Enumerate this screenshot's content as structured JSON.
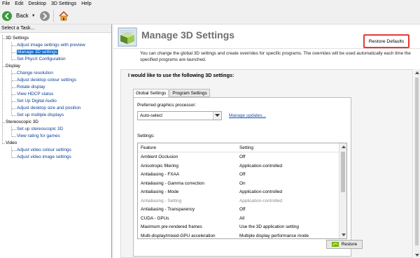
{
  "menu": [
    "File",
    "Edit",
    "Desktop",
    "3D Settings",
    "Help"
  ],
  "toolbar": {
    "back_label": "Back"
  },
  "sidebar": {
    "title": "Select a Task...",
    "tree": [
      {
        "label": "3D Settings",
        "children": [
          "Adjust image settings with preview",
          "Manage 3D settings",
          "Set PhysX Configuration"
        ]
      },
      {
        "label": "Display",
        "children": [
          "Change resolution",
          "Adjust desktop colour settings",
          "Rotate display",
          "View HDCP status",
          "Set Up Digital Audio",
          "Adjust desktop size and position",
          "Set up multiple displays"
        ]
      },
      {
        "label": "Stereoscopic 3D",
        "children": [
          "Set up stereoscopic 3D",
          "View rating for games"
        ]
      },
      {
        "label": "Video",
        "children": [
          "Adjust video colour settings",
          "Adjust video image settings"
        ]
      }
    ],
    "selected": "Manage 3D settings"
  },
  "main": {
    "title": "Manage 3D Settings",
    "restore_defaults": "Restore Defaults",
    "description": "You can change the global 3D settings and create overrides for specific programs. The overrides will be used automatically each time the specified programs are launched.",
    "section_title": "I would like to use the following 3D settings:",
    "tabs": [
      "Global Settings",
      "Program Settings"
    ],
    "preferred_label": "Preferred graphics processor:",
    "preferred_value": "Auto-select",
    "manage_updates": "Manage updates...",
    "settings_label": "Settings:",
    "columns": [
      "Feature",
      "Setting"
    ],
    "rows": [
      {
        "feature": "Ambient Occlusion",
        "setting": "Off",
        "disabled": false
      },
      {
        "feature": "Anisotropic filtering",
        "setting": "Application-controlled",
        "disabled": false
      },
      {
        "feature": "Antialiasing - FXAA",
        "setting": "Off",
        "disabled": false
      },
      {
        "feature": "Antialiasing - Gamma correction",
        "setting": "On",
        "disabled": false
      },
      {
        "feature": "Antialiasing - Mode",
        "setting": "Application-controlled",
        "disabled": false
      },
      {
        "feature": "Antialiasing - Setting",
        "setting": "Application-controlled",
        "disabled": true
      },
      {
        "feature": "Antialiasing - Transparency",
        "setting": "Off",
        "disabled": false
      },
      {
        "feature": "CUDA - GPUs",
        "setting": "All",
        "disabled": false
      },
      {
        "feature": "Maximum pre-rendered frames",
        "setting": "Use the 3D application setting",
        "disabled": false
      },
      {
        "feature": "Multi-display/mixed-GPU acceleration",
        "setting": "Multiple display performance mode",
        "disabled": false
      }
    ],
    "restore_button": "Restore"
  }
}
